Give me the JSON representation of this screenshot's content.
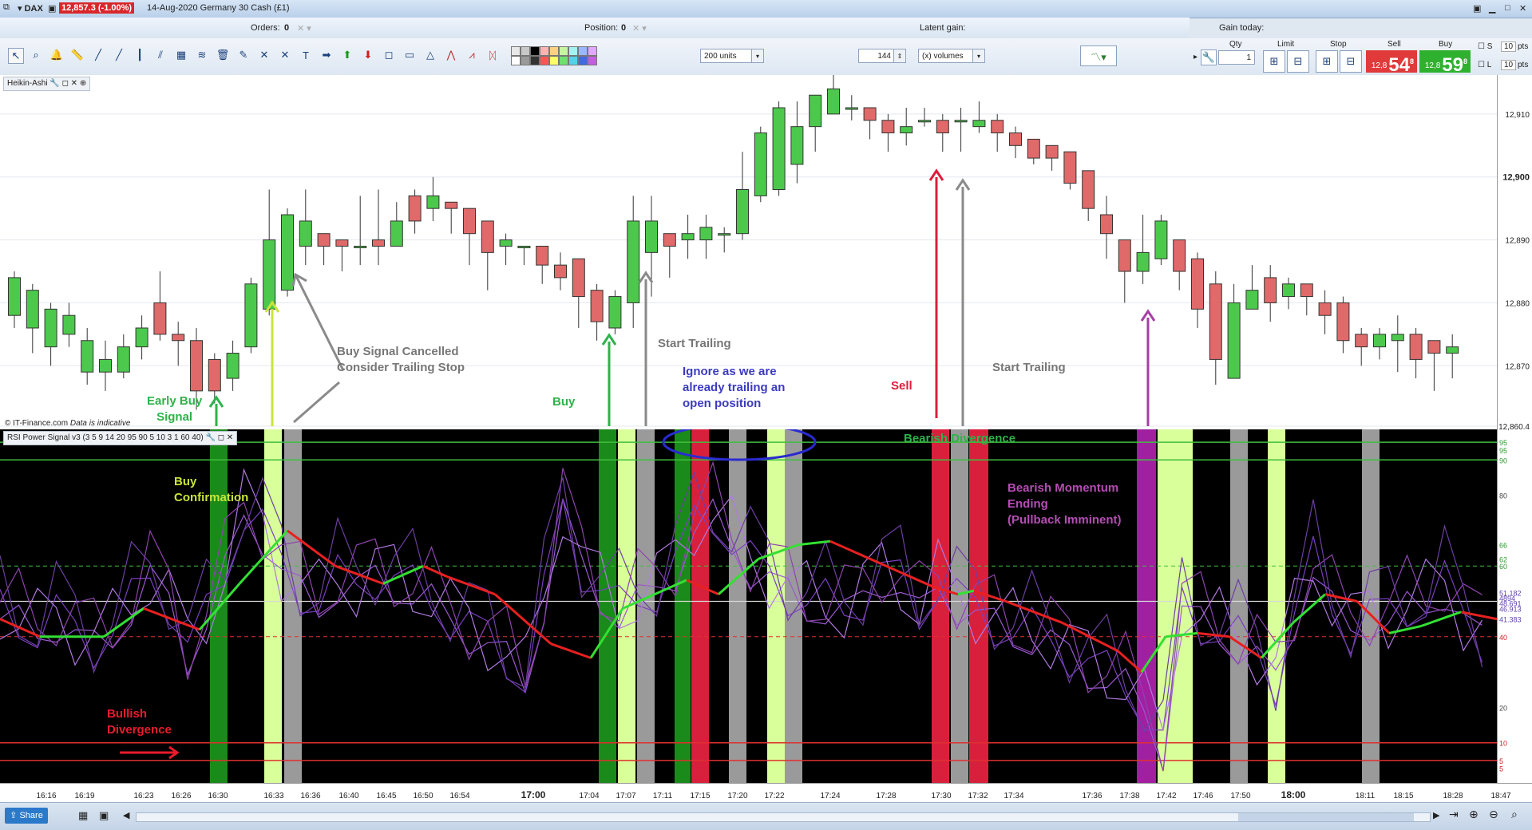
{
  "window": {
    "instrument": "DAX",
    "price_badge": "12,857.3 (-1.00%)",
    "date_title": "14-Aug-2020 Germany 30 Cash (£1)"
  },
  "orders_bar": {
    "orders_label": "Orders:",
    "orders_value": "0",
    "position_label": "Position:",
    "position_value": "0",
    "latent_label": "Latent gain:",
    "gain_today_label": "Gain today:"
  },
  "toolbar": {
    "units_select": "200 units",
    "volume_value": "144",
    "volume_unit": "(x) volumes"
  },
  "trade_panel": {
    "qty_label": "Qty",
    "qty_value": "1",
    "limit_label": "Limit",
    "stop_label": "Stop",
    "sell_label": "Sell",
    "buy_label": "Buy",
    "sell_prefix": "12,8",
    "sell_big": "54",
    "sell_sup": "8",
    "buy_prefix": "12,8",
    "buy_big": "59",
    "buy_sup": "8",
    "s_label": "S",
    "l_label": "L",
    "s_pts": "10",
    "l_pts": "10",
    "pts_label": "pts"
  },
  "main_panel": {
    "header": "Heikin-Ashi",
    "copyright": "© IT-Finance.com",
    "indicative": "Data is indicative",
    "price_labels": [
      {
        "text": "12,910",
        "value": 12910
      },
      {
        "text": "12,900",
        "value": 12900,
        "bold": true
      },
      {
        "text": "12,890",
        "value": 12890
      },
      {
        "text": "12,880",
        "value": 12880
      },
      {
        "text": "12,870",
        "value": 12870
      },
      {
        "text": "12,860.4",
        "value": 12860.4
      }
    ]
  },
  "rsi_panel": {
    "header": "RSI Power Signal v3 (3 5 9 14 20 95 90 5 10 3 1 60 40)",
    "levels": [
      "95",
      "95",
      "90",
      "80",
      "66",
      "62",
      "60",
      "51.182",
      "4894",
      "48.691",
      "46.913",
      "41.383",
      "40",
      "20",
      "10",
      "5",
      "5"
    ]
  },
  "annotations": {
    "early_buy": [
      "Early Buy",
      "Signal"
    ],
    "buy_cancel": [
      "Buy Signal Cancelled",
      "Consider Trailing Stop"
    ],
    "buy": "Buy",
    "start_trailing_1": "Start Trailing",
    "ignore": [
      "Ignore as we are",
      "already trailing an",
      "open position"
    ],
    "sell": "Sell",
    "start_trailing_2": "Start Trailing",
    "buy_confirm": [
      "Buy",
      "Confirmation"
    ],
    "bearish_div": "Bearish Divergence",
    "bearish_mom": [
      "Bearish Momentum",
      "Ending",
      "(Pullback Imminent)"
    ],
    "bullish_div": [
      "Bullish",
      "Divergence"
    ]
  },
  "time_axis": {
    "ticks": [
      "16:16",
      "16:19",
      "16:23",
      "16:26",
      "16:30",
      "16:33",
      "16:36",
      "16:40",
      "16:45",
      "16:50",
      "16:54",
      "17:00",
      "17:04",
      "17:07",
      "17:11",
      "17:15",
      "17:20",
      "17:22",
      "17:24",
      "17:28",
      "17:30",
      "17:32",
      "17:34",
      "17:36",
      "17:38",
      "17:42",
      "17:46",
      "17:50",
      "18:00",
      "18:11",
      "18:15",
      "18:28",
      "18:47"
    ]
  },
  "bottom": {
    "share_label": "Share"
  },
  "chart_data": {
    "type": "candlestick",
    "style": "Heikin-Ashi",
    "ylim": [
      12860.4,
      12916
    ],
    "colors": {
      "up": "#4cc94c",
      "down": "#e06a6a"
    },
    "candles": [
      [
        12878,
        12884,
        12885,
        12876
      ],
      [
        12876,
        12882,
        12883,
        12872
      ],
      [
        12873,
        12879,
        12880,
        12870
      ],
      [
        12875,
        12878,
        12880,
        12873
      ],
      [
        12869,
        12874,
        12876,
        12867
      ],
      [
        12869,
        12871,
        12874,
        12866
      ],
      [
        12869,
        12873,
        12875,
        12868
      ],
      [
        12873,
        12876,
        12878,
        12871
      ],
      [
        12880,
        12875,
        12885,
        12874
      ],
      [
        12875,
        12874,
        12877,
        12870
      ],
      [
        12874,
        12866,
        12876,
        12863
      ],
      [
        12871,
        12866,
        12872,
        12864
      ],
      [
        12868,
        12872,
        12874,
        12866
      ],
      [
        12873,
        12883,
        12884,
        12872
      ],
      [
        12879,
        12890,
        12898,
        12878
      ],
      [
        12882,
        12894,
        12895,
        12881
      ],
      [
        12889,
        12893,
        12898,
        12886
      ],
      [
        12891,
        12889,
        12891,
        12886
      ],
      [
        12890,
        12889,
        12890,
        12885
      ],
      [
        12889,
        12889,
        12897,
        12886
      ],
      [
        12890,
        12889,
        12898,
        12886
      ],
      [
        12889,
        12893,
        12896,
        12889
      ],
      [
        12897,
        12893,
        12898,
        12891
      ],
      [
        12895,
        12897,
        12900,
        12893
      ],
      [
        12896,
        12895,
        12896,
        12891
      ],
      [
        12895,
        12891,
        12895,
        12886
      ],
      [
        12893,
        12888,
        12893,
        12882
      ],
      [
        12889,
        12890,
        12891,
        12886
      ],
      [
        12889,
        12889,
        12889,
        12886
      ],
      [
        12889,
        12886,
        12889,
        12883
      ],
      [
        12886,
        12884,
        12888,
        12882
      ],
      [
        12887,
        12881,
        12887,
        12876
      ],
      [
        12882,
        12877,
        12883,
        12874
      ],
      [
        12876,
        12881,
        12882,
        12875
      ],
      [
        12880,
        12893,
        12897,
        12876
      ],
      [
        12888,
        12893,
        12897,
        12881
      ],
      [
        12891,
        12889,
        12891,
        12884
      ],
      [
        12890,
        12891,
        12894,
        12887
      ],
      [
        12890,
        12892,
        12894,
        12887
      ],
      [
        12891,
        12891,
        12892,
        12888
      ],
      [
        12891,
        12898,
        12904,
        12890
      ],
      [
        12897,
        12907,
        12908,
        12896
      ],
      [
        12898,
        12911,
        12912,
        12897
      ],
      [
        12902,
        12908,
        12912,
        12899
      ],
      [
        12908,
        12913,
        12913,
        12904
      ],
      [
        12910,
        12914,
        12917,
        12910
      ],
      [
        12911,
        12911,
        12913,
        12909
      ],
      [
        12911,
        12909,
        12911,
        12906
      ],
      [
        12909,
        12907,
        12910,
        12904
      ],
      [
        12907,
        12908,
        12911,
        12905
      ],
      [
        12909,
        12909,
        12911,
        12908
      ],
      [
        12909,
        12907,
        12910,
        12904
      ],
      [
        12909,
        12909,
        12911,
        12904
      ],
      [
        12908,
        12909,
        12912,
        12907
      ],
      [
        12909,
        12907,
        12910,
        12904
      ],
      [
        12907,
        12905,
        12908,
        12903
      ],
      [
        12906,
        12903,
        12906,
        12902
      ],
      [
        12905,
        12903,
        12905,
        12901
      ],
      [
        12904,
        12899,
        12904,
        12898
      ],
      [
        12901,
        12895,
        12901,
        12893
      ],
      [
        12894,
        12891,
        12897,
        12887
      ],
      [
        12890,
        12885,
        12890,
        12880
      ],
      [
        12885,
        12888,
        12894,
        12883
      ],
      [
        12887,
        12893,
        12894,
        12886
      ],
      [
        12890,
        12885,
        12890,
        12882
      ],
      [
        12887,
        12879,
        12888,
        12876
      ],
      [
        12883,
        12871,
        12885,
        12867
      ],
      [
        12868,
        12880,
        12883,
        12868
      ],
      [
        12879,
        12882,
        12886,
        12879
      ],
      [
        12884,
        12880,
        12886,
        12877
      ],
      [
        12881,
        12883,
        12884,
        12879
      ],
      [
        12883,
        12881,
        12883,
        12878
      ],
      [
        12880,
        12878,
        12882,
        12875
      ],
      [
        12880,
        12874,
        12881,
        12872
      ],
      [
        12875,
        12873,
        12876,
        12870
      ],
      [
        12873,
        12875,
        12876,
        12871
      ],
      [
        12874,
        12875,
        12878,
        12869
      ],
      [
        12875,
        12871,
        12876,
        12868
      ],
      [
        12874,
        12872,
        12874,
        12866
      ],
      [
        12872,
        12873,
        12875,
        12868
      ]
    ]
  }
}
